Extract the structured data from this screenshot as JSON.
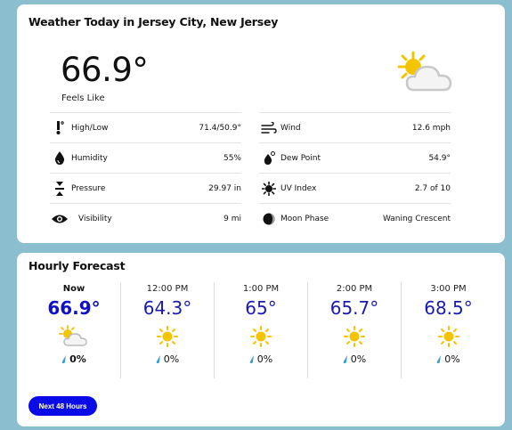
{
  "today": {
    "title": "Weather Today in Jersey City, New Jersey",
    "temperature": "66.9°",
    "feels_like_label": "Feels Like",
    "condition_icon": "partly-cloudy-icon",
    "details_left": [
      {
        "icon": "thermometer-icon",
        "label": "High/Low",
        "value": "71.4/50.9°"
      },
      {
        "icon": "humidity-icon",
        "label": "Humidity",
        "value": "55%"
      },
      {
        "icon": "pressure-icon",
        "label": "Pressure",
        "value": "29.97 in"
      },
      {
        "icon": "visibility-icon",
        "label": "Visibility",
        "value": "9 mi"
      }
    ],
    "details_right": [
      {
        "icon": "wind-icon",
        "label": "Wind",
        "value": "12.6 mph"
      },
      {
        "icon": "dew-point-icon",
        "label": "Dew Point",
        "value": "54.9°"
      },
      {
        "icon": "uv-index-icon",
        "label": "UV Index",
        "value": "2.7 of 10"
      },
      {
        "icon": "moon-phase-icon",
        "label": "Moon Phase",
        "value": "Waning Crescent"
      }
    ]
  },
  "hourly": {
    "title": "Hourly Forecast",
    "hours": [
      {
        "time": "Now",
        "temp": "66.9°",
        "icon": "partly-cloudy-icon",
        "precip": "0%"
      },
      {
        "time": "12:00 PM",
        "temp": "64.3°",
        "icon": "sun-icon",
        "precip": "0%"
      },
      {
        "time": "1:00 PM",
        "temp": "65°",
        "icon": "sun-icon",
        "precip": "0%"
      },
      {
        "time": "2:00 PM",
        "temp": "65.7°",
        "icon": "sun-icon",
        "precip": "0%"
      },
      {
        "time": "3:00 PM",
        "temp": "68.5°",
        "icon": "sun-icon",
        "precip": "0%"
      }
    ],
    "next_button_label": "Next 48 Hours"
  },
  "colors": {
    "background": "#8bbfcf",
    "temp_blue": "#1a1ab0",
    "button_blue": "#0a0ae6",
    "sun_yellow": "#f5c400",
    "drop_blue": "#3a9bd6"
  }
}
